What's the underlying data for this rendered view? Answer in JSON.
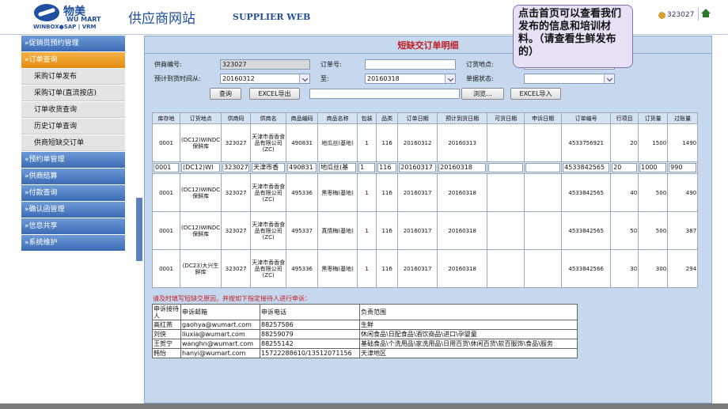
{
  "header": {
    "logo_cn": "物美",
    "logo_en": "WU MART",
    "logo_sub": "WINBOX●SAP | VRM",
    "site_title": "供应商网站",
    "site_title_en": "SUPPLIER WEB",
    "user": "323027"
  },
  "note": "点击首页可以查看我们发布的信息和培训材料。（请查看生鲜发布的）",
  "sidebar": {
    "items": [
      {
        "label": "»促销员预约管理",
        "active": false
      },
      {
        "label": "»订单查询",
        "active": true
      }
    ],
    "subitems": [
      "采购订单发布",
      "采购订单(直流按店)",
      "订单收货查询",
      "历史订单查询",
      "供商短缺交订单"
    ],
    "items_after": [
      "»预约单管理",
      "»供商结算",
      "»付款查询",
      "»确认函管理",
      "»信息共享",
      "»系统维护"
    ]
  },
  "main": {
    "title": "短缺交订单明细",
    "form": {
      "supplier_label": "供商编号:",
      "supplier_value": "323027",
      "order_no_label": "订单号:",
      "order_no_value": "",
      "location_label": "订货地点:",
      "location_value": "",
      "date_from_label": "预计到货时间从:",
      "date_from_value": "20160312",
      "date_to_label": "至:",
      "date_to_value": "20160318",
      "status_label": "单据状态:",
      "status_value": "",
      "query_btn": "查询",
      "export_btn": "EXCEL导出",
      "file_value": "",
      "browse_btn": "浏览...",
      "import_btn": "EXCEL导入"
    },
    "table": {
      "headers": [
        "库存地",
        "订货地点",
        "供商码",
        "供商名",
        "商品编码",
        "商品名称",
        "包装",
        "品类",
        "订单日期",
        "预计到货日期",
        "可货日期",
        "申诉日期",
        "订单编号",
        "行项目",
        "订货量",
        "过账量"
      ],
      "rows": [
        {
          "cells": [
            "0001",
            "(DC12)WINDC保鲜库",
            "323027",
            "天津市香香食品有限公司(ZC)",
            "490831",
            "地瓜丝(基地)",
            "1",
            "116",
            "20160312",
            "20160313",
            "",
            "",
            "4533756921",
            "20",
            "1500",
            "1490"
          ],
          "edit": false
        },
        {
          "cells": [
            "0001",
            "(DC12)WI",
            "323027",
            "天津市香",
            "490831",
            "地瓜丝(基",
            "1",
            "116",
            "20160317",
            "20160318",
            "",
            "",
            "4533842565",
            "20",
            "1000",
            "990"
          ],
          "edit": true
        },
        {
          "cells": [
            "0001",
            "(DC12)WINDC保鲜库",
            "323027",
            "天津市香香食品有限公司(ZC)",
            "495336",
            "黑枣梅(基地)",
            "1",
            "116",
            "20160317",
            "20160318",
            "",
            "",
            "4533842565",
            "40",
            "500",
            "490"
          ],
          "edit": false
        },
        {
          "cells": [
            "0001",
            "(DC12)WINDC保鲜库",
            "323027",
            "天津市香香食品有限公司(ZC)",
            "495337",
            "真情梅(基地)",
            "1",
            "116",
            "20160317",
            "20160318",
            "",
            "",
            "4533842565",
            "50",
            "500",
            "387"
          ],
          "edit": false
        },
        {
          "cells": [
            "0001",
            "(DC23)大兴生鲜库",
            "323027",
            "天津市香香食品有限公司(ZC)",
            "495336",
            "黑枣梅(基地)",
            "1",
            "116",
            "20160317",
            "20160318",
            "",
            "",
            "4533842566",
            "30",
            "300",
            "294"
          ],
          "edit": false
        }
      ]
    },
    "notice": "请及时填写短缺交原因，并按如下指定接待人进行申诉：",
    "contacts": {
      "headers": [
        "申诉接待人",
        "申诉邮箱",
        "申诉电话",
        "负责范围"
      ],
      "rows": [
        [
          "高红燕",
          "gaohya@wumart.com",
          "88257586",
          "生鲜"
        ],
        [
          "刘侠",
          "liuxia@wumart.com",
          "88259079",
          "休闲食品\\日配食品\\酒饮商品\\进口\\孕婴童"
        ],
        [
          "王贺宁",
          "wanghn@wumart.com",
          "88255142",
          "基础食品\\个洗用品\\家洗用品\\日用百货\\休闲百货\\软百服饰\\食品\\服务"
        ],
        [
          "韩怡",
          "hanyi@wumart.com",
          "15722288610/13512071156",
          "天津地区"
        ]
      ]
    }
  }
}
